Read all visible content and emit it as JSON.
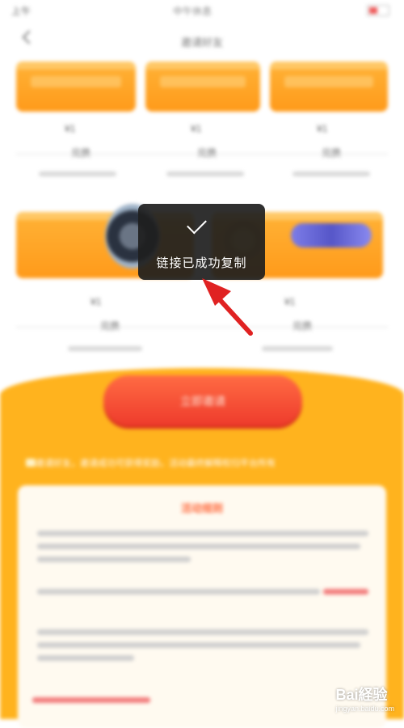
{
  "status": {
    "time": "上午",
    "center": "中午休息"
  },
  "header": {
    "title": "邀请好友"
  },
  "cards_top": [
    {
      "price": "¥1",
      "sub": "兑换"
    },
    {
      "price": "¥1",
      "sub": "兑换"
    },
    {
      "price": "¥1",
      "sub": "兑换"
    }
  ],
  "cards_bottom": [
    {
      "price": "¥1",
      "sub": "兑换"
    },
    {
      "price": "¥1",
      "sub": "兑换"
    }
  ],
  "cta": {
    "label": "立即邀请"
  },
  "notice": {
    "text": "邀请好友，邀请成功可获得奖励，活动最终解释权归平台所有"
  },
  "rules": {
    "title": "活动规则"
  },
  "toast": {
    "message": "链接已成功复制"
  },
  "watermark": {
    "brand": "Bai経验",
    "url": "jingyan.baidu.com"
  },
  "colors": {
    "accent": "#ffb31e",
    "cta": "#ee3b2c",
    "arrow": "#e02222"
  }
}
